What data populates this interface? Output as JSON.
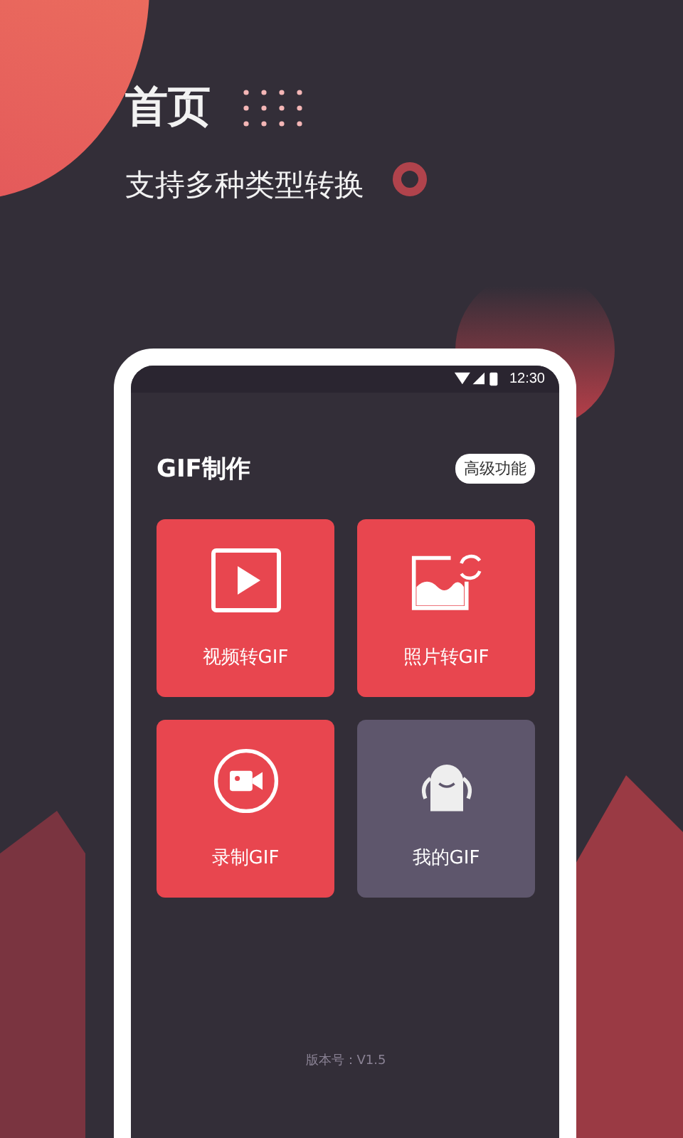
{
  "header": {
    "title": "首页",
    "subtitle": "支持多种类型转换"
  },
  "phone": {
    "status_bar": {
      "time": "12:30"
    },
    "section": {
      "title": "GIF制作",
      "action": "高级功能"
    },
    "tiles": [
      {
        "kind": "video",
        "label": "视频转GIF",
        "color": "#e8464f"
      },
      {
        "kind": "photo",
        "label": "照片转GIF",
        "color": "#e8464f"
      },
      {
        "kind": "record",
        "label": "录制GIF",
        "color": "#e8464f"
      },
      {
        "kind": "mine",
        "label": "我的GIF",
        "color": "#5e566c"
      }
    ],
    "version": "版本号：V1.5"
  }
}
